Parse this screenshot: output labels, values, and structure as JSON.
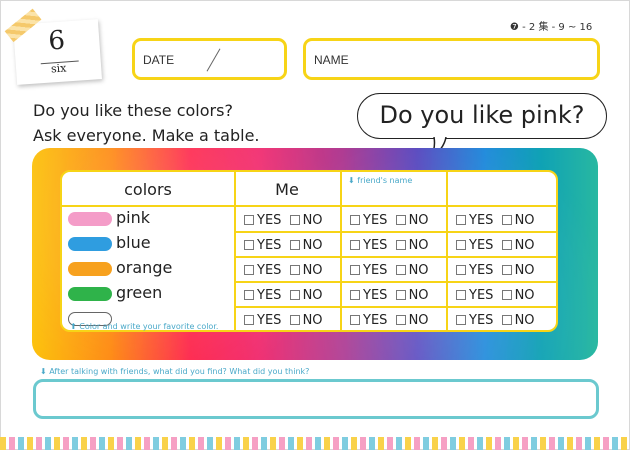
{
  "lesson": {
    "number": "6",
    "word": "six"
  },
  "page_ref": "❼ - 2 集 - 9 ~ 16",
  "fields": {
    "date_label": "DATE",
    "name_label": "NAME"
  },
  "instructions": {
    "line1": "Do you like these colors?",
    "line2": "Ask everyone.  Make a table."
  },
  "speech_bubble": "Do you like pink?",
  "table": {
    "col_colors": "colors",
    "col_me": "Me",
    "friends_hint": "⬇ friend's name",
    "yes": "YES",
    "no": "NO",
    "rows": [
      {
        "name": "pink",
        "color": "#f49cc8"
      },
      {
        "name": "blue",
        "color": "#2f9de0"
      },
      {
        "name": "orange",
        "color": "#f7a11e"
      },
      {
        "name": "green",
        "color": "#2fb34a"
      },
      {
        "name": "",
        "color": "#ffffff"
      }
    ],
    "favorite_hint": "⬆ Color and write your favorite color."
  },
  "reflection_prompt": "⬇ After talking with friends, what did you find?  What did you think?",
  "stripe_colors": [
    "#f9d24a",
    "#f6a0c4",
    "#7fcde0"
  ]
}
